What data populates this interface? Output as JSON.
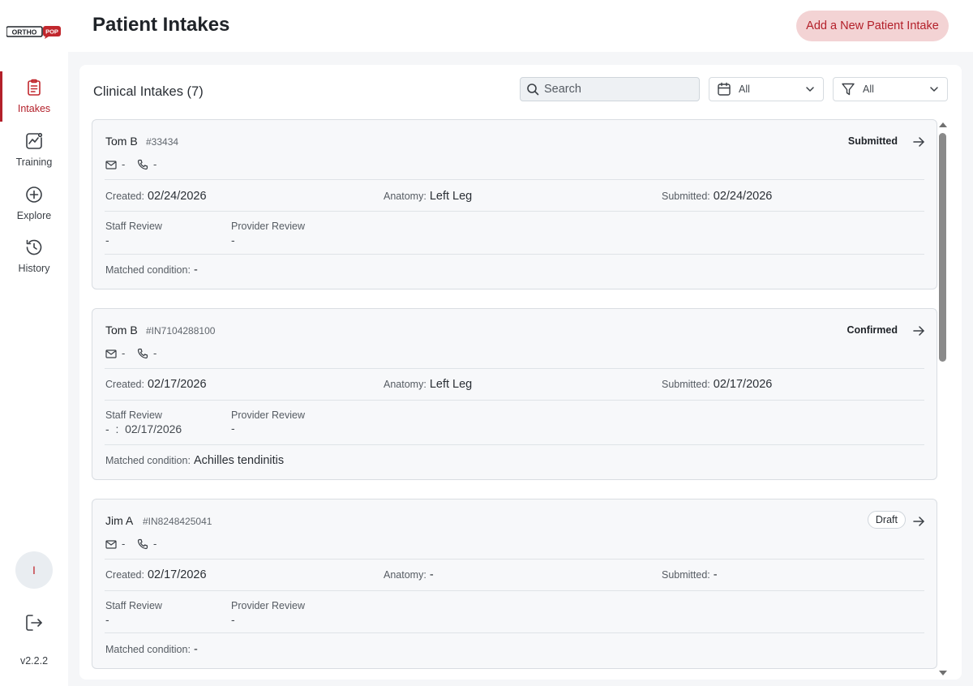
{
  "brand": {
    "logo_text_left": "ORTHO",
    "logo_text_right": "POP",
    "accent": "#b3202a"
  },
  "sidebar": {
    "items": [
      {
        "label": "Intakes",
        "icon": "clipboard-icon",
        "active": true
      },
      {
        "label": "Training",
        "icon": "chart-icon",
        "active": false
      },
      {
        "label": "Explore",
        "icon": "plus-circle-icon",
        "active": false
      },
      {
        "label": "History",
        "icon": "history-icon",
        "active": false
      }
    ],
    "avatar_initial": "I",
    "version": "v2.2.2"
  },
  "header": {
    "title": "Patient Intakes",
    "add_button": "Add a New Patient Intake"
  },
  "panel": {
    "title": "Clinical Intakes (7)",
    "search_placeholder": "Search",
    "date_filter": "All",
    "status_filter": "All"
  },
  "labels": {
    "created": "Created:",
    "anatomy": "Anatomy:",
    "submitted": "Submitted:",
    "staff_review": "Staff Review",
    "provider_review": "Provider Review",
    "matched_condition": "Matched condition:"
  },
  "intakes": [
    {
      "name": "Tom B",
      "id": "#33434",
      "status": "Submitted",
      "email": "-",
      "phone": "-",
      "created": "02/24/2026",
      "anatomy": "Left Leg",
      "submitted": "02/24/2026",
      "staff_review": "-",
      "provider_review": "-",
      "matched_condition": "-"
    },
    {
      "name": "Tom B",
      "id": "#IN7104288100",
      "status": "Confirmed",
      "email": "-",
      "phone": "-",
      "created": "02/17/2026",
      "anatomy": "Left Leg",
      "submitted": "02/17/2026",
      "staff_review": "-  :  02/17/2026",
      "provider_review": "-",
      "matched_condition": "Achilles tendinitis"
    },
    {
      "name": "Jim A",
      "id": "#IN8248425041",
      "status": "Draft",
      "email": "-",
      "phone": "-",
      "created": "02/17/2026",
      "anatomy": "-",
      "submitted": "-",
      "staff_review": "-",
      "provider_review": "-",
      "matched_condition": "-"
    }
  ]
}
